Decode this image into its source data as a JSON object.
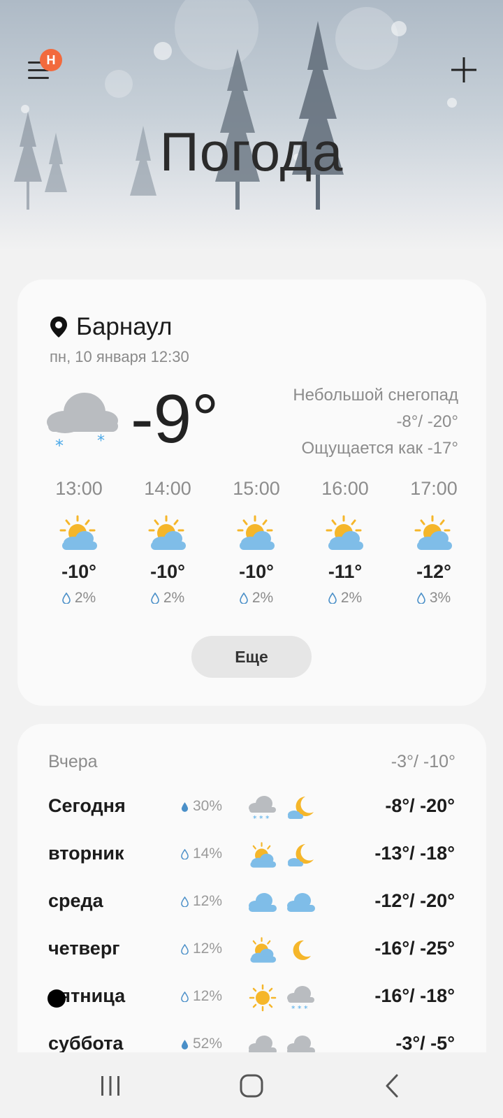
{
  "app": {
    "title": "Погода",
    "menu_badge": "Н",
    "accent_badge_color": "#f26a3d"
  },
  "current": {
    "location": "Барнаул",
    "datetime": "пн, 10 января 12:30",
    "temperature": "-9°",
    "condition": "Небольшой снегопад",
    "high_low": "-8°/ -20°",
    "feels_like": "Ощущается как -17°",
    "icon": "cloud-snow-icon"
  },
  "hourly": [
    {
      "time": "13:00",
      "temp": "-10°",
      "precip": "2%",
      "icon": "partly-sunny-icon"
    },
    {
      "time": "14:00",
      "temp": "-10°",
      "precip": "2%",
      "icon": "partly-sunny-icon"
    },
    {
      "time": "15:00",
      "temp": "-10°",
      "precip": "2%",
      "icon": "partly-sunny-icon"
    },
    {
      "time": "16:00",
      "temp": "-11°",
      "precip": "2%",
      "icon": "partly-sunny-icon"
    },
    {
      "time": "17:00",
      "temp": "-12°",
      "precip": "3%",
      "icon": "partly-sunny-icon"
    }
  ],
  "more_label": "Еще",
  "yesterday": {
    "label": "Вчера",
    "range": "-3°/ -10°"
  },
  "daily": [
    {
      "day": "Сегодня",
      "precip": "30%",
      "day_icon": "cloud-snow-icon",
      "night_icon": "moon-cloud-icon",
      "range": "-8°/ -20°"
    },
    {
      "day": "вторник",
      "precip": "14%",
      "day_icon": "partly-sunny-icon",
      "night_icon": "moon-cloud-icon",
      "range": "-13°/ -18°"
    },
    {
      "day": "среда",
      "precip": "12%",
      "day_icon": "cloud-icon",
      "night_icon": "cloud-icon",
      "range": "-12°/ -20°"
    },
    {
      "day": "четверг",
      "precip": "12%",
      "day_icon": "partly-sunny-icon",
      "night_icon": "moon-icon",
      "range": "-16°/ -25°"
    },
    {
      "day": "пятница",
      "precip": "12%",
      "day_icon": "sun-icon",
      "night_icon": "cloud-snow-icon",
      "range": "-16°/ -18°"
    },
    {
      "day": "суббота",
      "precip": "52%",
      "day_icon": "cloud-gray-icon",
      "night_icon": "cloud-gray-icon",
      "range": "-3°/ -5°"
    }
  ]
}
